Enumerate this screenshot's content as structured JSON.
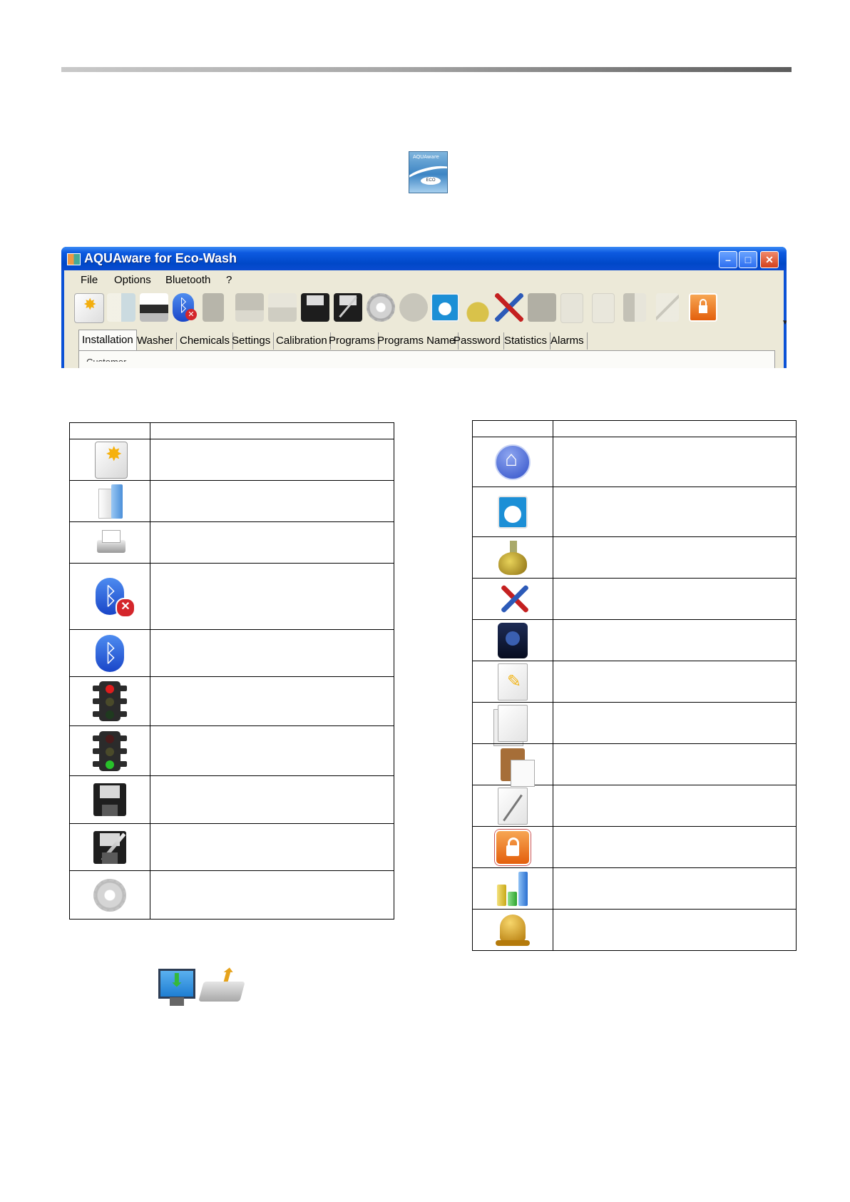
{
  "logo": {
    "line1": "AQUAware",
    "badge": "ECO"
  },
  "window": {
    "title": "AQUAware for Eco-Wash",
    "menu": [
      "File",
      "Options",
      "Bluetooth",
      "?"
    ],
    "toolbar_icons": [
      "new-file-icon",
      "open-folder-icon",
      "printer-icon",
      "bluetooth-disconnected-icon",
      "traffic-light-icon",
      "upload-icon",
      "download-icon",
      "save-icon",
      "save-as-icon",
      "gear-icon",
      "home-icon",
      "washer-icon",
      "flask-icon",
      "tools-icon",
      "pump-icon",
      "edit-document-icon",
      "copy-icon",
      "paste-icon",
      "pen-icon",
      "lock-icon"
    ],
    "tabs": [
      "Installation",
      "Washer",
      "Chemicals",
      "Settings",
      "Calibration",
      "Programs",
      "Programs Name",
      "Password",
      "Statistics",
      "Alarms"
    ],
    "active_tab": "Installation",
    "groupbox_label": "Customer"
  },
  "left_table_icons": [
    "new-file-icon",
    "open-folder-icon",
    "printer-icon",
    "bluetooth-disconnected-icon",
    "bluetooth-icon",
    "traffic-light-red-icon",
    "traffic-light-green-icon",
    "save-icon",
    "save-as-icon",
    "gear-icon"
  ],
  "right_table_icons": [
    "home-icon",
    "washer-icon",
    "flask-icon",
    "tools-icon",
    "pump-icon",
    "edit-document-icon",
    "copy-icon",
    "paste-icon",
    "pen-document-icon",
    "lock-icon",
    "statistics-icon",
    "bell-icon"
  ],
  "bottom_icons": [
    "download-to-pc-icon",
    "upload-from-drive-icon"
  ]
}
